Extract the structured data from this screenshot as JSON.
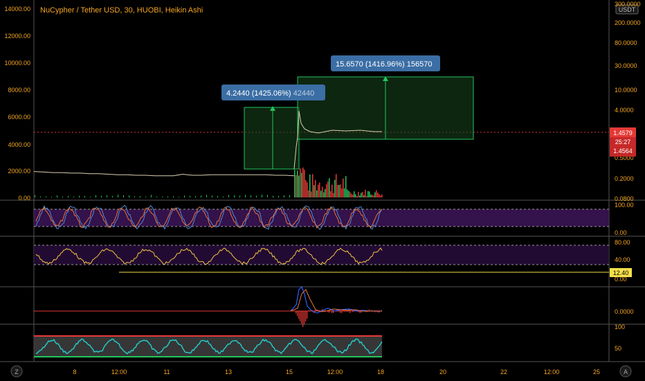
{
  "header": {
    "symbol_title": "NuCypher / Tether USD, 30, HUOBI, Heikin Ashi",
    "currency_badge": "USDT"
  },
  "colors": {
    "background": "#000000",
    "accent_text": "#f5a623",
    "range_box": "#22c55e",
    "tooltip_bg": "#3b6ea5",
    "price_line": "#e53935",
    "rsi_band": "#4a1a6b",
    "macd_up": "#2962ff",
    "macd_down": "#e53935"
  },
  "measure_labels": {
    "first": {
      "main": "4.2440 (1425.06%)",
      "extra": "42440"
    },
    "second": {
      "main": "15.6570 (1416.96%)",
      "extra": "156570"
    }
  },
  "price_labels": {
    "last": "1.4579",
    "countdown": "25:27",
    "other": "1.4564"
  },
  "indicator_value": "12.40",
  "corner_buttons": {
    "left": "Z",
    "right": "A"
  },
  "chart_data": [
    {
      "type": "line",
      "panel": "price",
      "title": "NuCypher / Tether USD, 30, HUOBI, Heikin Ashi",
      "left_axis_ticks": [
        "14000.00",
        "12000.00",
        "10000.00",
        "8000.00",
        "6000.00",
        "4000.00",
        "2000.00",
        "0.00"
      ],
      "right_axis_ticks": [
        "300.0000",
        "200.0000",
        "80.0000",
        "30.0000",
        "10.0000",
        "4.0000",
        "0.2000",
        "0.0800"
      ],
      "right_axis_partial": "0.5000",
      "x_ticks": [
        "8",
        "12:00",
        "11",
        "13",
        "15",
        "12:00",
        "18",
        "20",
        "22",
        "12:00",
        "25"
      ],
      "scale": "log",
      "series": [
        {
          "x": [
            0,
            20,
            40,
            60,
            80,
            100,
            120,
            140,
            160,
            180,
            200,
            220,
            240,
            260,
            280,
            300,
            320,
            340,
            360,
            380,
            400,
            420,
            440,
            460,
            480,
            500,
            520,
            540,
            560
          ],
          "y": [
            0.48,
            0.47,
            0.46,
            0.46,
            0.45,
            0.45,
            0.44,
            0.44,
            0.43,
            0.42,
            0.42,
            0.41,
            0.41,
            0.4,
            0.4,
            0.4,
            0.43,
            0.41,
            0.41,
            0.42,
            0.42,
            0.42,
            0.42,
            0.42,
            0.42,
            0.42,
            0.41,
            0.41,
            0.4
          ]
        }
      ],
      "annotations": [
        "4.2440 (1425.06%) 42440",
        "15.6570 (1416.96%) 156570"
      ]
    },
    {
      "type": "line",
      "panel": "stoch_rsi",
      "right_axis_ticks": [
        "100.00",
        "0.00"
      ]
    },
    {
      "type": "line",
      "panel": "rsi",
      "right_axis_ticks": [
        "80.00",
        "40.00",
        "0.00"
      ],
      "last_value": "12.40"
    },
    {
      "type": "bar",
      "panel": "macd",
      "right_axis_ticks": [
        "0.0000"
      ]
    },
    {
      "type": "line",
      "panel": "oscillator",
      "right_axis_ticks": [
        "100",
        "50"
      ]
    }
  ]
}
